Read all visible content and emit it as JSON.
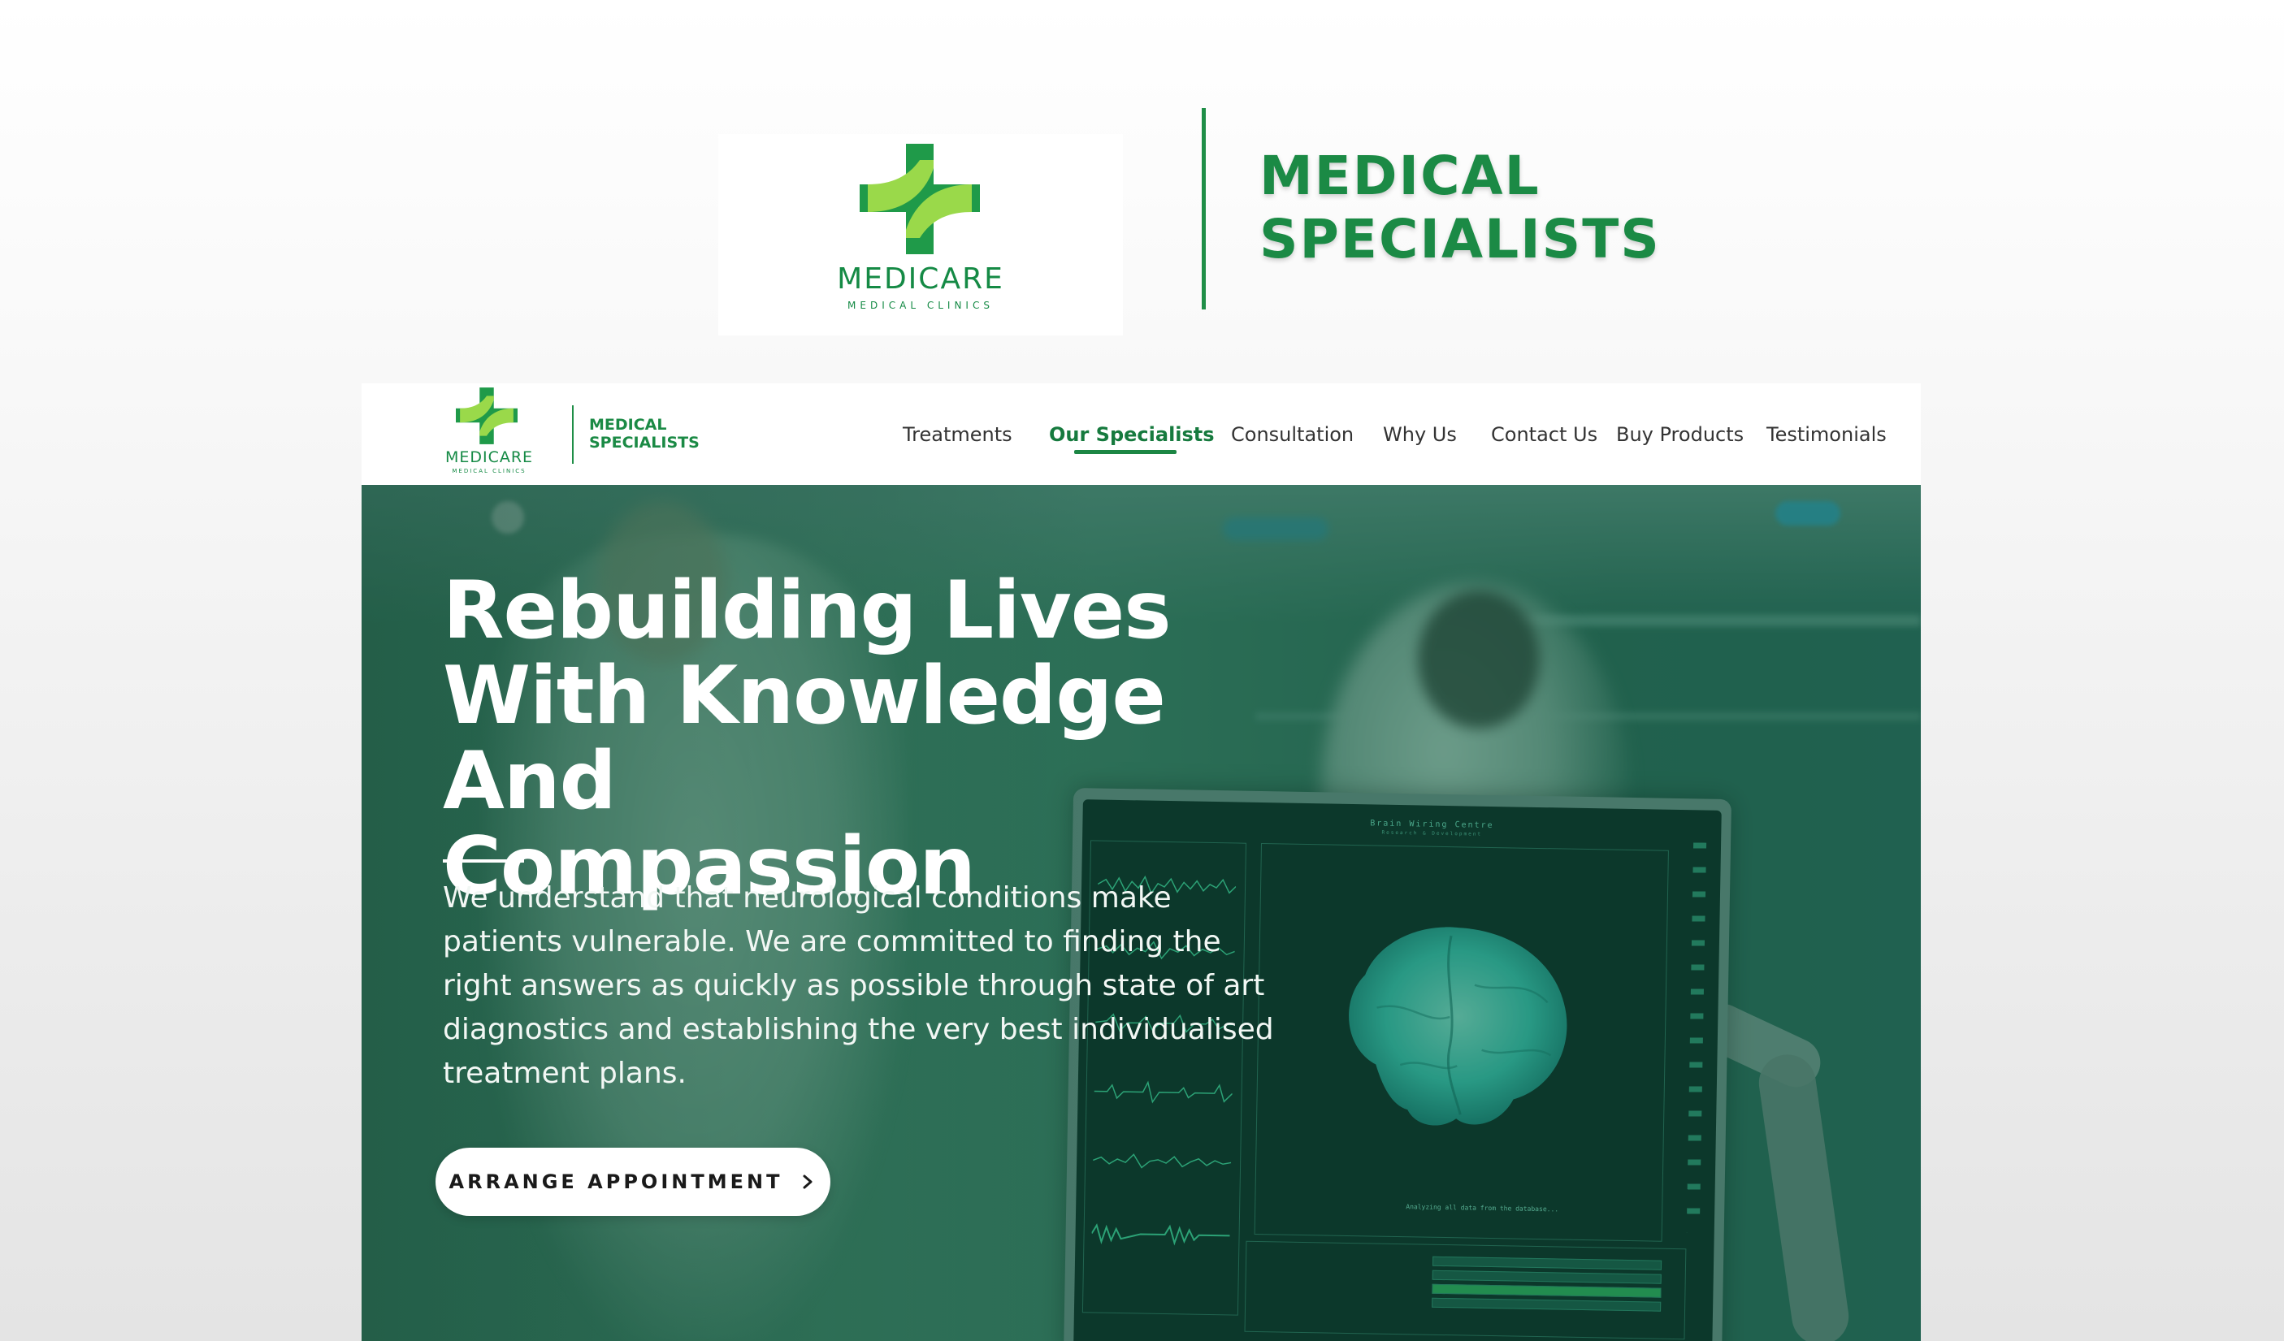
{
  "brand": {
    "logo_word": "MEDICARE",
    "logo_sub": "MEDICAL CLINICS",
    "title_line1": "MEDICAL",
    "title_line2": "SPECIALISTS"
  },
  "colors": {
    "brand_green": "#1b8a45",
    "light_green": "#8fd44a",
    "nav_text": "#333333",
    "hero_overlay": "#0e543c"
  },
  "nav": {
    "items": [
      {
        "label": "Treatments",
        "active": false
      },
      {
        "label": "Our Specialists",
        "active": true
      },
      {
        "label": "Consultation",
        "active": false
      },
      {
        "label": "Why Us",
        "active": false
      },
      {
        "label": "Contact Us",
        "active": false
      },
      {
        "label": "Buy Products",
        "active": false
      },
      {
        "label": "Testimonials",
        "active": false
      }
    ]
  },
  "hero": {
    "title_lines": [
      "Rebuilding Lives",
      "With Knowledge And",
      "Compassion"
    ],
    "body_lines": [
      "We understand that neurological conditions make",
      "patients vulnerable. We are committed to finding the",
      "right answers as quickly as possible through state of art",
      "diagnostics and establishing the very best individualised",
      "treatment plans."
    ],
    "cta_label": "ARRANGE APPOINTMENT",
    "cta_icon": "chevron-right-icon"
  },
  "monitor": {
    "title": "Brain Wiring Centre",
    "subtitle": "Research & Development",
    "caption": "Analyzing all data from the database..."
  }
}
